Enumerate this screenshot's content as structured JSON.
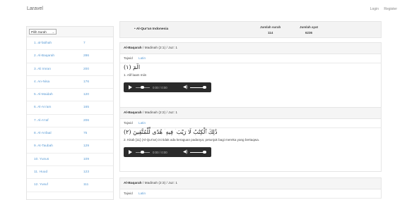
{
  "navbar": {
    "brand": "Laravel",
    "links": [
      "Login",
      "Register"
    ]
  },
  "sidebar": {
    "select": {
      "value": "Pilih Surah"
    },
    "surahs": [
      {
        "name": "1. al-fatihah",
        "count": "7"
      },
      {
        "name": "2. Al-Baqarah",
        "count": "286"
      },
      {
        "name": "3. Ali Imran",
        "count": "200"
      },
      {
        "name": "4. An-Nisa",
        "count": "176"
      },
      {
        "name": "5. Al-Maidah",
        "count": "120"
      },
      {
        "name": "6. Al-An'am",
        "count": "165"
      },
      {
        "name": "7. Al-A'raf",
        "count": "206"
      },
      {
        "name": "8. Al-Anfaal",
        "count": "75"
      },
      {
        "name": "9. At-Taubah",
        "count": "129"
      },
      {
        "name": "10. Yunus",
        "count": "109"
      },
      {
        "name": "11. Huud",
        "count": "123"
      },
      {
        "name": "12. Yusuf",
        "count": "111"
      }
    ]
  },
  "info": {
    "title": "• Al-Qur'an Indonesia",
    "surah_label": "Jumlah surah",
    "surah_value": "114",
    "ayat_label": "Jumlah ayat",
    "ayat_value": "6236"
  },
  "ayat": [
    {
      "surah": "Al-Baqarah",
      "meta": " / Madinah (2:1) / Juz: 1",
      "tab_tajwid": "Tajwid",
      "tab_latin": "Latin",
      "arabic": "الٓمٓ (١)",
      "translation": "1. Alif laam miin",
      "time": "0:00 / 0:00"
    },
    {
      "surah": "Al-Baqarah",
      "meta": " / Madinah (2:2) / Juz: 1",
      "tab_tajwid": "Tajwid",
      "tab_latin": "Latin",
      "arabic": "ذَٰلِكَ ٱلْكِتَٰبُ لَا رَيْبَ ۛ فِيهِ ۛ هُدًى لِّلْمُتَّقِينَ (٢)",
      "translation": "2. Kitab [11] (Al-Qur'an) ini tidak ada keraguan padanya; petunjuk bagi mereka yang bertaqwa.",
      "time": "0:00 / 0:00"
    },
    {
      "surah": "Al-Baqarah",
      "meta": " / Madinah (2:3) / Juz: 1",
      "tab_tajwid": "Tajwid",
      "tab_latin": "Latin"
    }
  ],
  "icons": {
    "play": "play-icon",
    "volume": "volume-icon",
    "chevron": "chevron-down-icon"
  }
}
